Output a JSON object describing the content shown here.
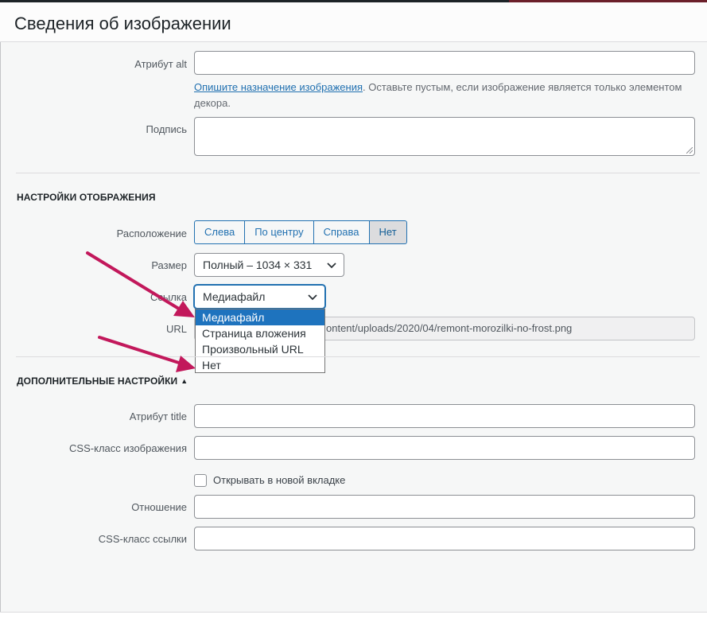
{
  "header": {
    "title": "Сведения об изображении"
  },
  "fields": {
    "alt_label": "Атрибут alt",
    "alt_value": "",
    "alt_help_link": "Опишите назначение изображения",
    "alt_help_text": ". Оставьте пустым, если изображение является только элементом декора.",
    "caption_label": "Подпись",
    "caption_value": ""
  },
  "display": {
    "title": "НАСТРОЙКИ ОТОБРАЖЕНИЯ",
    "align_label": "Расположение",
    "align_options": [
      "Слева",
      "По центру",
      "Справа",
      "Нет"
    ],
    "align_selected": "Нет",
    "size_label": "Размер",
    "size_value": "Полный – 1034 × 331",
    "link_label": "Ссылка",
    "link_value": "Медиафайл",
    "link_options": [
      "Медиафайл",
      "Страница вложения",
      "Произвольный URL",
      "Нет"
    ],
    "url_label": "URL",
    "url_value": "ontent/uploads/2020/04/remont-morozilki-no-frost.png"
  },
  "advanced": {
    "title": "ДОПОЛНИТЕЛЬНЫЕ НАСТРОЙКИ",
    "toggle_icon": "▲",
    "title_attr_label": "Атрибут title",
    "image_class_label": "CSS-класс изображения",
    "new_tab_label": "Открывать в новой вкладке",
    "new_tab_checked": false,
    "rel_label": "Отношение",
    "link_class_label": "CSS-класс ссылки"
  },
  "colors": {
    "accent": "#2271b1",
    "arrow": "#c2185b",
    "selected_option": "#1e73be"
  },
  "annotations": {
    "arrow_icon": "arrow-pointer-icon"
  }
}
